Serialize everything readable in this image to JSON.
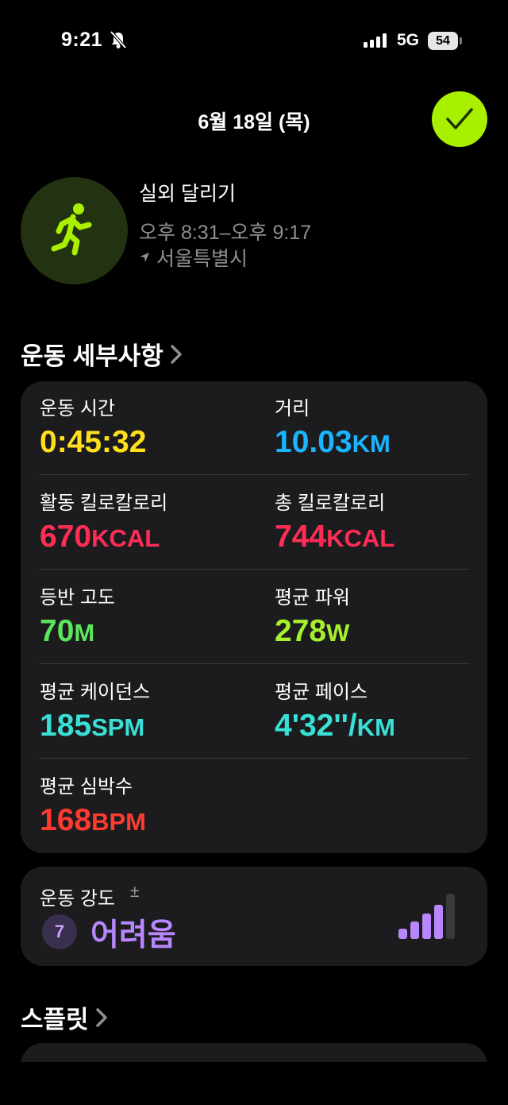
{
  "status_bar": {
    "time": "9:21",
    "network": "5G",
    "battery": "54",
    "icons": [
      "bell-slash-icon",
      "signal-icon",
      "battery-icon"
    ]
  },
  "header": {
    "date": "6월 18일 (목)",
    "done_icon": "checkmark-icon",
    "accent_color": "#a8f000"
  },
  "workout": {
    "icon": "running-figure-icon",
    "name": "실외 달리기",
    "time_range": "오후 8:31–오후 9:17",
    "location": "서울특별시",
    "location_icon": "location-arrow-icon"
  },
  "details": {
    "section_title": "운동 세부사항",
    "metrics": [
      {
        "label": "운동 시간",
        "value": "0:45:32",
        "unit": "",
        "color": "#ffe01b"
      },
      {
        "label": "거리",
        "value": "10.03",
        "unit": "KM",
        "color": "#1ab4ff"
      },
      {
        "label": "활동 킬로칼로리",
        "value": "670",
        "unit": "KCAL",
        "color": "#ff2d55"
      },
      {
        "label": "총 킬로칼로리",
        "value": "744",
        "unit": "KCAL",
        "color": "#ff2d55"
      },
      {
        "label": "등반 고도",
        "value": "70",
        "unit": "M",
        "color": "#5ce65c"
      },
      {
        "label": "평균 파워",
        "value": "278",
        "unit": "W",
        "color": "#a6f02c"
      },
      {
        "label": "평균 케이던스",
        "value": "185",
        "unit": "SPM",
        "color": "#39e0d6"
      },
      {
        "label": "평균 페이스",
        "value": "4'32''/",
        "unit": "KM",
        "color": "#39e0d6"
      },
      {
        "label": "평균 심박수",
        "value": "168",
        "unit": "BPM",
        "color": "#ff3b30"
      }
    ]
  },
  "effort": {
    "label": "운동 강도",
    "adjust_symbol": "±",
    "level": "7",
    "level_text": "어려움",
    "filled_bars": 4,
    "total_bars": 5,
    "color": "#b887ff"
  },
  "splits": {
    "section_title": "스플릿"
  }
}
